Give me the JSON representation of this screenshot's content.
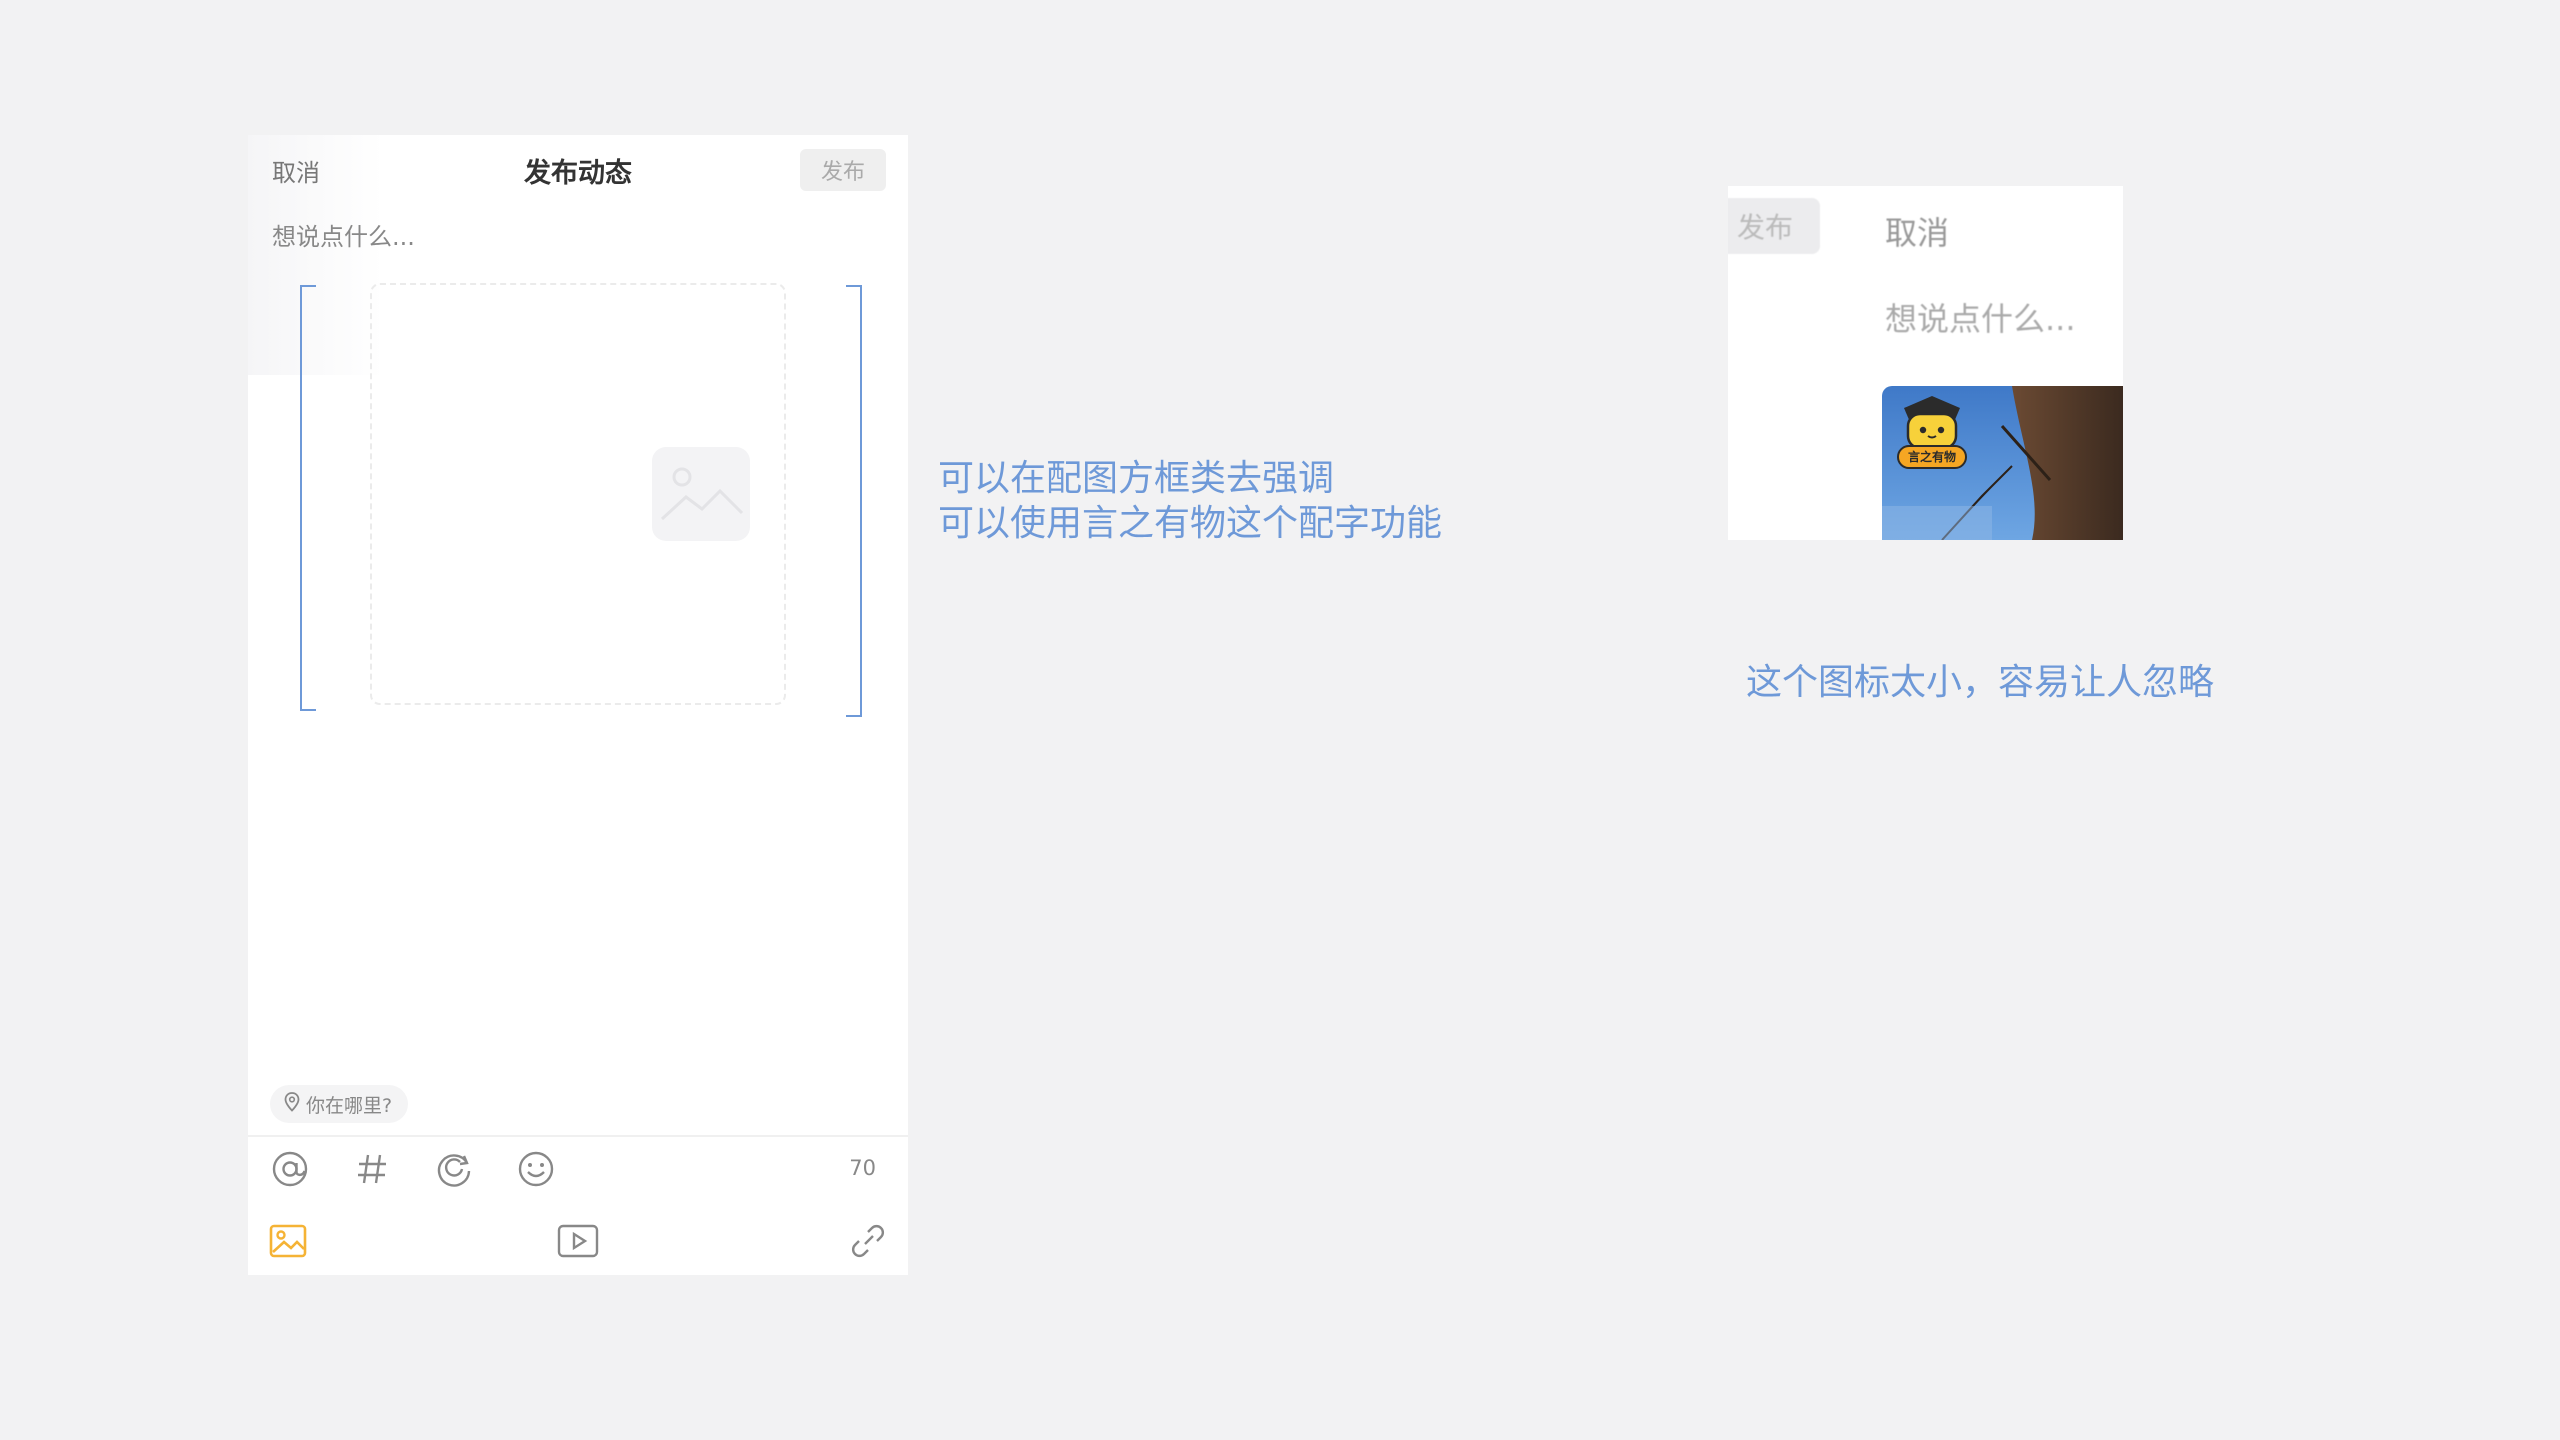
{
  "phone": {
    "cancel_label": "取消",
    "title": "发布动态",
    "publish_label": "发布",
    "input_placeholder": "想说点什么...",
    "location_label": "你在哪里?",
    "char_count": "70"
  },
  "snapshot": {
    "publish_label": "发布",
    "cancel_label": "取消",
    "input_placeholder": "想说点什么...",
    "sticker_text": "言之有物"
  },
  "annotations": {
    "note1_line1": "可以在配图方框类去强调",
    "note1_line2": "可以使用言之有物这个配字功能",
    "note2": "这个图标太小，容易让人忽略"
  },
  "colors": {
    "annotation": "#6e99d8",
    "accent_image_icon": "#f5b335",
    "background": "#f2f2f3"
  }
}
